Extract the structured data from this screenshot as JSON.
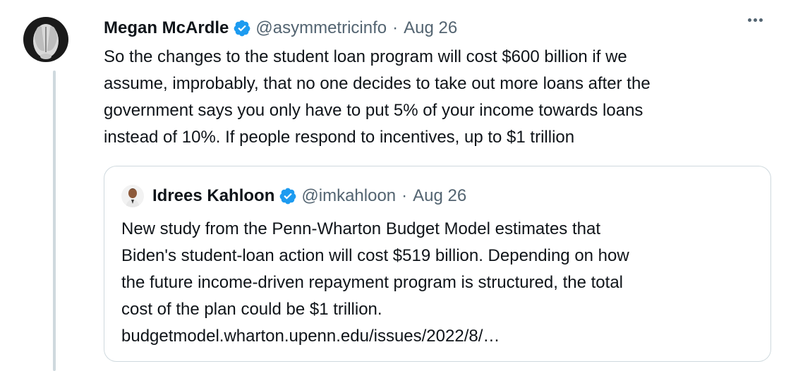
{
  "tweet": {
    "author_name": "Megan McArdle",
    "handle": "@asymmetricinfo",
    "separator": "·",
    "date": "Aug 26",
    "text": "So the changes to the student loan program will cost $600 billion if we\nassume, improbably, that no one decides to take out more loans after the\ngovernment says you only have to put 5% of your income towards loans\ninstead of 10%. If people respond to incentives, up to $1 trillion"
  },
  "quote": {
    "author_name": "Idrees Kahloon",
    "handle": "@imkahloon",
    "separator": "·",
    "date": "Aug 26",
    "text": "New study from the Penn-Wharton Budget Model estimates that\nBiden's student-loan action will cost $519 billion. Depending on how\nthe future income-driven repayment program is structured, the total\ncost of the plan could be $1 trillion.\nbudgetmodel.wharton.upenn.edu/issues/2022/8/…"
  },
  "icons": {
    "verified": "verified-badge-icon",
    "more": "more-options-icon"
  },
  "colors": {
    "verified": "#1d9bf0",
    "text": "#0f1419",
    "secondary": "#536471",
    "border": "#cfd9de"
  }
}
